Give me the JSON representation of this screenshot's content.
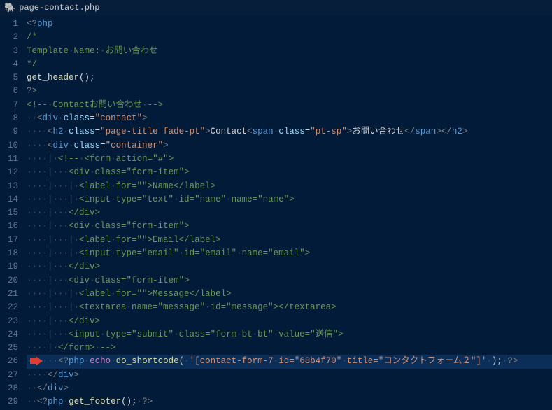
{
  "tab": {
    "filename": "page-contact.php",
    "icon": "php-icon"
  },
  "lines": [
    {
      "n": 1,
      "hl": false,
      "tokens": [
        {
          "c": "t-delim",
          "t": "<?"
        },
        {
          "c": "t-tag",
          "t": "php"
        }
      ]
    },
    {
      "n": 2,
      "hl": false,
      "tokens": [
        {
          "c": "t-comm",
          "t": "/*"
        }
      ]
    },
    {
      "n": 3,
      "hl": false,
      "tokens": [
        {
          "c": "t-comm",
          "t": "Template"
        },
        {
          "c": "t-ws",
          "t": "·"
        },
        {
          "c": "t-comm",
          "t": "Name:"
        },
        {
          "c": "t-ws",
          "t": "·"
        },
        {
          "c": "t-comm",
          "t": "お問い合わせ"
        }
      ]
    },
    {
      "n": 4,
      "hl": false,
      "tokens": [
        {
          "c": "t-comm",
          "t": "*/"
        }
      ]
    },
    {
      "n": 5,
      "hl": false,
      "tokens": [
        {
          "c": "t-func",
          "t": "get_header"
        },
        {
          "c": "t-punc",
          "t": "();"
        }
      ]
    },
    {
      "n": 6,
      "hl": false,
      "tokens": [
        {
          "c": "t-delim",
          "t": "?>"
        }
      ]
    },
    {
      "n": 7,
      "hl": false,
      "tokens": [
        {
          "c": "t-comm",
          "t": "<!--"
        },
        {
          "c": "t-ws",
          "t": "·"
        },
        {
          "c": "t-comm",
          "t": "Contactお問い合わせ"
        },
        {
          "c": "t-ws",
          "t": "·"
        },
        {
          "c": "t-comm",
          "t": "-->"
        }
      ]
    },
    {
      "n": 8,
      "hl": false,
      "tokens": [
        {
          "c": "t-ws",
          "t": "··"
        },
        {
          "c": "t-delim",
          "t": "<"
        },
        {
          "c": "t-tag",
          "t": "div"
        },
        {
          "c": "t-ws",
          "t": "·"
        },
        {
          "c": "t-attr",
          "t": "class"
        },
        {
          "c": "t-punc",
          "t": "="
        },
        {
          "c": "t-str",
          "t": "\"contact\""
        },
        {
          "c": "t-delim",
          "t": ">"
        }
      ]
    },
    {
      "n": 9,
      "hl": false,
      "tokens": [
        {
          "c": "t-ws",
          "t": "····"
        },
        {
          "c": "t-delim",
          "t": "<"
        },
        {
          "c": "t-tag",
          "t": "h2"
        },
        {
          "c": "t-ws",
          "t": "·"
        },
        {
          "c": "t-attr",
          "t": "class"
        },
        {
          "c": "t-punc",
          "t": "="
        },
        {
          "c": "t-str",
          "t": "\"page-title fade-pt\""
        },
        {
          "c": "t-delim",
          "t": ">"
        },
        {
          "c": "t-text",
          "t": "Contact"
        },
        {
          "c": "t-delim",
          "t": "<"
        },
        {
          "c": "t-tag",
          "t": "span"
        },
        {
          "c": "t-ws",
          "t": "·"
        },
        {
          "c": "t-attr",
          "t": "class"
        },
        {
          "c": "t-punc",
          "t": "="
        },
        {
          "c": "t-str",
          "t": "\"pt-sp\""
        },
        {
          "c": "t-delim",
          "t": ">"
        },
        {
          "c": "t-text",
          "t": "お問い合わせ"
        },
        {
          "c": "t-delim",
          "t": "</"
        },
        {
          "c": "t-tag",
          "t": "span"
        },
        {
          "c": "t-delim",
          "t": ">"
        },
        {
          "c": "t-delim",
          "t": "</"
        },
        {
          "c": "t-tag",
          "t": "h2"
        },
        {
          "c": "t-delim",
          "t": ">"
        }
      ]
    },
    {
      "n": 10,
      "hl": false,
      "tokens": [
        {
          "c": "t-ws",
          "t": "····"
        },
        {
          "c": "t-delim",
          "t": "<"
        },
        {
          "c": "t-tag",
          "t": "div"
        },
        {
          "c": "t-ws",
          "t": "·"
        },
        {
          "c": "t-attr",
          "t": "class"
        },
        {
          "c": "t-punc",
          "t": "="
        },
        {
          "c": "t-str",
          "t": "\"container\""
        },
        {
          "c": "t-delim",
          "t": ">"
        }
      ]
    },
    {
      "n": 11,
      "hl": false,
      "tokens": [
        {
          "c": "t-ws",
          "t": "····|·"
        },
        {
          "c": "t-comm",
          "t": "<!--"
        },
        {
          "c": "t-ws",
          "t": "·"
        },
        {
          "c": "t-comm",
          "t": "<form"
        },
        {
          "c": "t-ws",
          "t": "·"
        },
        {
          "c": "t-comm",
          "t": "action=\"#\">"
        }
      ]
    },
    {
      "n": 12,
      "hl": false,
      "tokens": [
        {
          "c": "t-ws",
          "t": "····|···"
        },
        {
          "c": "t-comm",
          "t": "<div"
        },
        {
          "c": "t-ws",
          "t": "·"
        },
        {
          "c": "t-comm",
          "t": "class=\"form-item\">"
        }
      ]
    },
    {
      "n": 13,
      "hl": false,
      "tokens": [
        {
          "c": "t-ws",
          "t": "····|···|·"
        },
        {
          "c": "t-comm",
          "t": "<label"
        },
        {
          "c": "t-ws",
          "t": "·"
        },
        {
          "c": "t-comm",
          "t": "for=\"\">Name</label>"
        }
      ]
    },
    {
      "n": 14,
      "hl": false,
      "tokens": [
        {
          "c": "t-ws",
          "t": "····|···|·"
        },
        {
          "c": "t-comm",
          "t": "<input"
        },
        {
          "c": "t-ws",
          "t": "·"
        },
        {
          "c": "t-comm",
          "t": "type=\"text\""
        },
        {
          "c": "t-ws",
          "t": "·"
        },
        {
          "c": "t-comm",
          "t": "id=\"name\""
        },
        {
          "c": "t-ws",
          "t": "·"
        },
        {
          "c": "t-comm",
          "t": "name=\"name\">"
        }
      ]
    },
    {
      "n": 15,
      "hl": false,
      "tokens": [
        {
          "c": "t-ws",
          "t": "····|···"
        },
        {
          "c": "t-comm",
          "t": "</div>"
        }
      ]
    },
    {
      "n": 16,
      "hl": false,
      "tokens": [
        {
          "c": "t-ws",
          "t": "····|···"
        },
        {
          "c": "t-comm",
          "t": "<div"
        },
        {
          "c": "t-ws",
          "t": "·"
        },
        {
          "c": "t-comm",
          "t": "class=\"form-item\">"
        }
      ]
    },
    {
      "n": 17,
      "hl": false,
      "tokens": [
        {
          "c": "t-ws",
          "t": "····|···|·"
        },
        {
          "c": "t-comm",
          "t": "<label"
        },
        {
          "c": "t-ws",
          "t": "·"
        },
        {
          "c": "t-comm",
          "t": "for=\"\">Email</label>"
        }
      ]
    },
    {
      "n": 18,
      "hl": false,
      "tokens": [
        {
          "c": "t-ws",
          "t": "····|···|·"
        },
        {
          "c": "t-comm",
          "t": "<input"
        },
        {
          "c": "t-ws",
          "t": "·"
        },
        {
          "c": "t-comm",
          "t": "type=\"email\""
        },
        {
          "c": "t-ws",
          "t": "·"
        },
        {
          "c": "t-comm",
          "t": "id=\"email\""
        },
        {
          "c": "t-ws",
          "t": "·"
        },
        {
          "c": "t-comm",
          "t": "name=\"email\">"
        }
      ]
    },
    {
      "n": 19,
      "hl": false,
      "tokens": [
        {
          "c": "t-ws",
          "t": "····|···"
        },
        {
          "c": "t-comm",
          "t": "</div>"
        }
      ]
    },
    {
      "n": 20,
      "hl": false,
      "tokens": [
        {
          "c": "t-ws",
          "t": "····|···"
        },
        {
          "c": "t-comm",
          "t": "<div"
        },
        {
          "c": "t-ws",
          "t": "·"
        },
        {
          "c": "t-comm",
          "t": "class=\"form-item\">"
        }
      ]
    },
    {
      "n": 21,
      "hl": false,
      "tokens": [
        {
          "c": "t-ws",
          "t": "····|···|·"
        },
        {
          "c": "t-comm",
          "t": "<label"
        },
        {
          "c": "t-ws",
          "t": "·"
        },
        {
          "c": "t-comm",
          "t": "for=\"\">Message</label>"
        }
      ]
    },
    {
      "n": 22,
      "hl": false,
      "tokens": [
        {
          "c": "t-ws",
          "t": "····|···|·"
        },
        {
          "c": "t-comm",
          "t": "<textarea"
        },
        {
          "c": "t-ws",
          "t": "·"
        },
        {
          "c": "t-comm",
          "t": "name=\"message\""
        },
        {
          "c": "t-ws",
          "t": "·"
        },
        {
          "c": "t-comm",
          "t": "id=\"message\"></textarea>"
        }
      ]
    },
    {
      "n": 23,
      "hl": false,
      "tokens": [
        {
          "c": "t-ws",
          "t": "····|···"
        },
        {
          "c": "t-comm",
          "t": "</div>"
        }
      ]
    },
    {
      "n": 24,
      "hl": false,
      "tokens": [
        {
          "c": "t-ws",
          "t": "····|···"
        },
        {
          "c": "t-comm",
          "t": "<input"
        },
        {
          "c": "t-ws",
          "t": "·"
        },
        {
          "c": "t-comm",
          "t": "type=\"submit\""
        },
        {
          "c": "t-ws",
          "t": "·"
        },
        {
          "c": "t-comm",
          "t": "class=\"form-bt"
        },
        {
          "c": "t-ws",
          "t": "·"
        },
        {
          "c": "t-comm",
          "t": "bt\""
        },
        {
          "c": "t-ws",
          "t": "·"
        },
        {
          "c": "t-comm",
          "t": "value=\"送信\">"
        }
      ]
    },
    {
      "n": 25,
      "hl": false,
      "tokens": [
        {
          "c": "t-ws",
          "t": "····|·"
        },
        {
          "c": "t-comm",
          "t": "</form>"
        },
        {
          "c": "t-ws",
          "t": "·"
        },
        {
          "c": "t-comm",
          "t": "-->"
        }
      ]
    },
    {
      "n": 26,
      "hl": true,
      "arrow": true,
      "tokens": [
        {
          "c": "t-ws",
          "t": "······"
        },
        {
          "c": "t-delim",
          "t": "<?"
        },
        {
          "c": "t-tag",
          "t": "php"
        },
        {
          "c": "t-ws",
          "t": "·"
        },
        {
          "c": "t-kw",
          "t": "echo"
        },
        {
          "c": "t-ws",
          "t": "·"
        },
        {
          "c": "t-func",
          "t": "do_shortcode"
        },
        {
          "c": "t-punc",
          "t": "("
        },
        {
          "c": "t-ws",
          "t": "·"
        },
        {
          "c": "t-str",
          "t": "'[contact-form-7"
        },
        {
          "c": "t-ws",
          "t": "·"
        },
        {
          "c": "t-str",
          "t": "id=\"68b4f70\""
        },
        {
          "c": "t-ws",
          "t": "·"
        },
        {
          "c": "t-str",
          "t": "title=\"コンタクトフォーム２\"]'"
        },
        {
          "c": "t-ws",
          "t": "·"
        },
        {
          "c": "t-punc",
          "t": ");"
        },
        {
          "c": "t-ws",
          "t": "·"
        },
        {
          "c": "t-delim",
          "t": "?>"
        }
      ]
    },
    {
      "n": 27,
      "hl": false,
      "tokens": [
        {
          "c": "t-ws",
          "t": "····"
        },
        {
          "c": "t-delim",
          "t": "</"
        },
        {
          "c": "t-tag",
          "t": "div"
        },
        {
          "c": "t-delim",
          "t": ">"
        }
      ]
    },
    {
      "n": 28,
      "hl": false,
      "tokens": [
        {
          "c": "t-ws",
          "t": "··"
        },
        {
          "c": "t-delim",
          "t": "</"
        },
        {
          "c": "t-tag",
          "t": "div"
        },
        {
          "c": "t-delim",
          "t": ">"
        }
      ]
    },
    {
      "n": 29,
      "hl": false,
      "tokens": [
        {
          "c": "t-ws",
          "t": "··"
        },
        {
          "c": "t-delim",
          "t": "<?"
        },
        {
          "c": "t-tag",
          "t": "php"
        },
        {
          "c": "t-ws",
          "t": "·"
        },
        {
          "c": "t-func",
          "t": "get_footer"
        },
        {
          "c": "t-punc",
          "t": "();"
        },
        {
          "c": "t-ws",
          "t": "·"
        },
        {
          "c": "t-delim",
          "t": "?>"
        }
      ]
    }
  ]
}
